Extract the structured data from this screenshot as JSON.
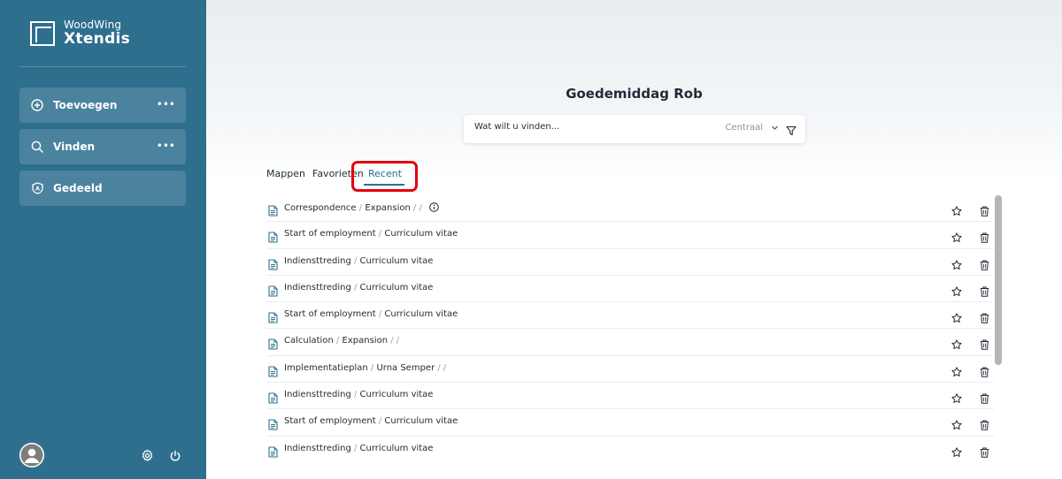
{
  "brand": {
    "line1": "WoodWing",
    "line2": "Xtendis"
  },
  "sidebar": {
    "items": [
      {
        "label": "Toevoegen",
        "icon": "plus-circle-icon",
        "more": "•••"
      },
      {
        "label": "Vinden",
        "icon": "search-icon",
        "more": "•••"
      },
      {
        "label": "Gedeeld",
        "icon": "shield-icon"
      }
    ],
    "footer": {
      "avatar": "avatar-icon",
      "settings": "gear-icon",
      "power": "power-icon"
    }
  },
  "main": {
    "greeting": "Goedemiddag Rob",
    "search": {
      "placeholder": "Wat wilt u vinden...",
      "scope": "Centraal",
      "filter_icon": "filter-icon"
    },
    "tabs": [
      {
        "label": "Mappen"
      },
      {
        "label": "Favorieten"
      },
      {
        "label": "Recent",
        "active": true
      }
    ],
    "recent": [
      {
        "title": "Correspondence",
        "subtitle": "Expansion",
        "extra": " / /",
        "info": true
      },
      {
        "title": "Start of employment",
        "subtitle": "Curriculum vitae"
      },
      {
        "title": "Indiensttreding",
        "subtitle": "Curriculum vitae"
      },
      {
        "title": "Indiensttreding",
        "subtitle": "Curriculum vitae"
      },
      {
        "title": "Start of employment",
        "subtitle": "Curriculum vitae"
      },
      {
        "title": "Calculation",
        "subtitle": "Expansion",
        "extra": " / /"
      },
      {
        "title": "Implementatieplan",
        "subtitle": "Urna Semper",
        "extra": " / /"
      },
      {
        "title": "Indiensttreding",
        "subtitle": "Curriculum vitae"
      },
      {
        "title": "Start of employment",
        "subtitle": "Curriculum vitae"
      },
      {
        "title": "Indiensttreding",
        "subtitle": "Curriculum vitae"
      }
    ]
  },
  "colors": {
    "sidebar": "#2e6f8e",
    "accent": "#2e6f8e",
    "highlight": "#e3000f"
  }
}
